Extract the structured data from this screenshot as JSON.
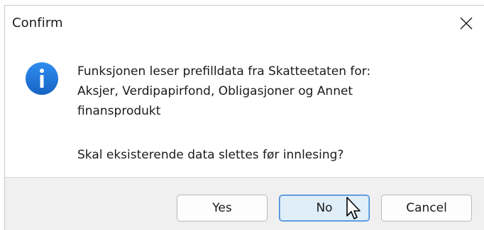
{
  "dialog": {
    "title": "Confirm",
    "close_icon": "close-icon",
    "icon": "info-icon",
    "message_lines": [
      "Funksjonen leser prefilldata fra Skatteetaten for:",
      "Aksjer, Verdipapirfond, Obligasjoner og Annet",
      "finansprodukt"
    ],
    "question": "Skal eksisterende data slettes før innlesing?",
    "buttons": {
      "yes": "Yes",
      "no": "No",
      "cancel": "Cancel"
    },
    "focused_button": "No"
  },
  "colors": {
    "info_icon": "#1e73d8",
    "footer_bg": "#f0f0f0",
    "focused_border": "#3c86d6",
    "focused_bg": "#e0eef9"
  }
}
